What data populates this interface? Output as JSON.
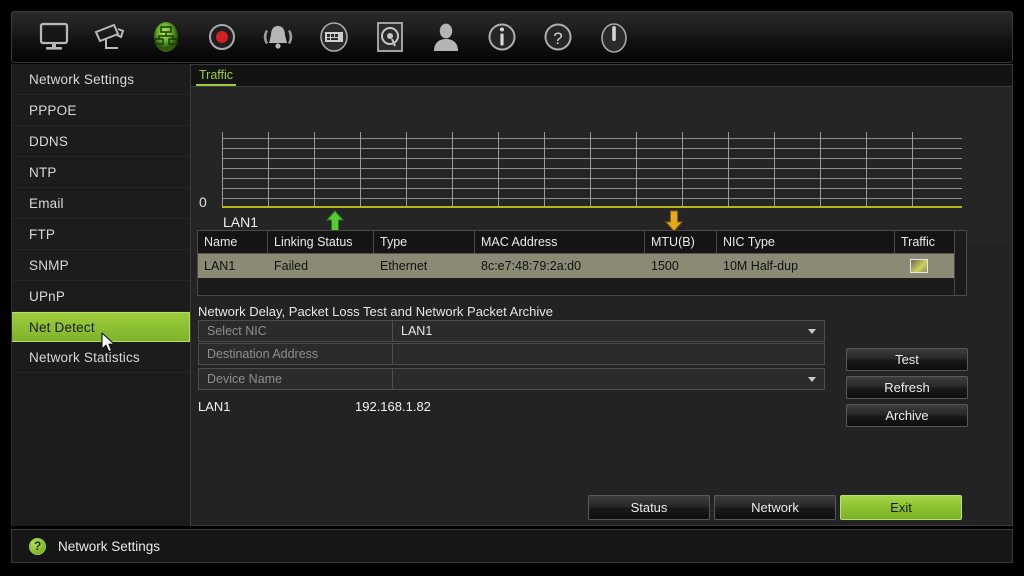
{
  "toolbar": {
    "items": [
      {
        "name": "monitor-icon",
        "label": "Playback"
      },
      {
        "name": "camera-icon",
        "label": "Camera"
      },
      {
        "name": "network-icon",
        "label": "Network",
        "active": true
      },
      {
        "name": "record-icon",
        "label": "Record"
      },
      {
        "name": "alarm-bell-icon",
        "label": "Alarm"
      },
      {
        "name": "device-icon",
        "label": "Device"
      },
      {
        "name": "hdd-icon",
        "label": "HDD"
      },
      {
        "name": "user-icon",
        "label": "User"
      },
      {
        "name": "info-icon",
        "label": "Information"
      },
      {
        "name": "help-icon",
        "label": "Help"
      },
      {
        "name": "power-icon",
        "label": "Shutdown"
      }
    ]
  },
  "sidebar": {
    "items": [
      {
        "label": "Network Settings",
        "active": false
      },
      {
        "label": "PPPOE",
        "active": false
      },
      {
        "label": "DDNS",
        "active": false
      },
      {
        "label": "NTP",
        "active": false
      },
      {
        "label": "Email",
        "active": false
      },
      {
        "label": "FTP",
        "active": false
      },
      {
        "label": "SNMP",
        "active": false
      },
      {
        "label": "UPnP",
        "active": false
      },
      {
        "label": "Net Detect",
        "active": true
      },
      {
        "label": "Network Statistics",
        "active": false
      }
    ]
  },
  "tabs": [
    {
      "label": "Traffic",
      "active": true
    }
  ],
  "chart_data": {
    "type": "line",
    "title": "Traffic",
    "series": [
      {
        "name": "Sending",
        "color": "#55cc33",
        "values": [
          0,
          0,
          0,
          0,
          0,
          0,
          0,
          0,
          0,
          0,
          0,
          0,
          0,
          0,
          0,
          0
        ]
      },
      {
        "name": "Receiving",
        "color": "#e8a81c",
        "values": [
          0,
          0,
          0,
          0,
          0,
          0,
          0,
          0,
          0,
          0,
          0,
          0,
          0,
          0,
          0,
          0
        ]
      }
    ],
    "x": [
      0,
      1,
      2,
      3,
      4,
      5,
      6,
      7,
      8,
      9,
      10,
      11,
      12,
      13,
      14,
      15
    ],
    "ylim": [
      0,
      7
    ],
    "ytick_labels": [
      "0"
    ],
    "xlabel": "",
    "ylabel": "",
    "grid": true,
    "h_gridlines": 7,
    "v_gridlines": 16,
    "baseline_color": "#b3b31e",
    "nic_label": "LAN1",
    "legend": [
      {
        "icon": "up-arrow-icon",
        "color": "#55cc33"
      },
      {
        "icon": "down-arrow-icon",
        "color": "#e8a81c"
      }
    ]
  },
  "table": {
    "columns": [
      "Name",
      "Linking Status",
      "Type",
      "MAC Address",
      "MTU(B)",
      "NIC Type",
      "Traffic"
    ],
    "rows": [
      {
        "name": "LAN1",
        "linking_status": "Failed",
        "type": "Ethernet",
        "mac_address": "8c:e7:48:79:2a:d0",
        "mtu": "1500",
        "nic_type": "10M Half-dup",
        "traffic": "traffic-chart-icon"
      }
    ]
  },
  "form": {
    "section_title": "Network Delay, Packet Loss Test and Network Packet Archive",
    "fields": [
      {
        "label": "Select NIC",
        "value": "LAN1",
        "type": "select"
      },
      {
        "label": "Destination Address",
        "value": "",
        "type": "text",
        "placeholder": ""
      },
      {
        "label": "Device Name",
        "value": "",
        "type": "select"
      }
    ],
    "nic_info": {
      "name": "LAN1",
      "address": "192.168.1.82"
    }
  },
  "side_buttons": [
    {
      "label": "Test"
    },
    {
      "label": "Refresh"
    },
    {
      "label": "Archive"
    }
  ],
  "bottom_buttons": [
    {
      "label": "Status",
      "style": "dark"
    },
    {
      "label": "Network",
      "style": "dark"
    },
    {
      "label": "Exit",
      "style": "green"
    }
  ],
  "statusbar": {
    "icon": "help-circle-icon",
    "text": "Network Settings"
  },
  "colors": {
    "accent_green": "#9ccd3c",
    "panel_bg": "#232323",
    "row_highlight": "#8b8a74",
    "chart_baseline": "#b3b31e",
    "arrow_up": "#55cc33",
    "arrow_down": "#e8a81c"
  }
}
